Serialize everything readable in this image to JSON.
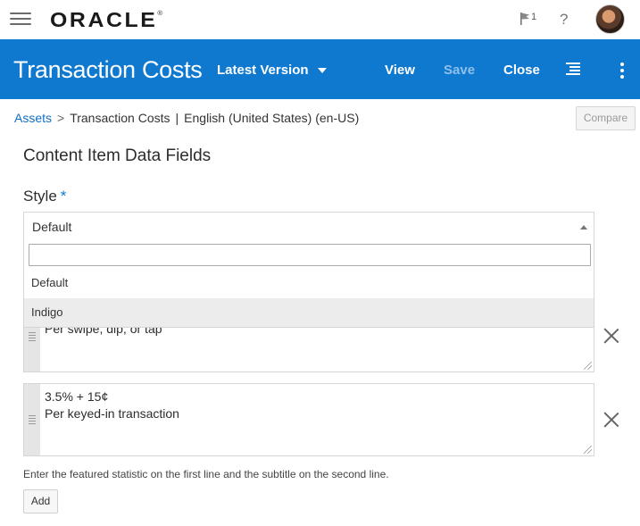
{
  "header": {
    "logo_text": "ORACLE",
    "logo_mark": "®",
    "notification_count": "1",
    "help_label": "?",
    "icons": {
      "menu": "hamburger-icon",
      "flag": "flag-icon",
      "help": "help-icon",
      "avatar": "user-avatar"
    }
  },
  "toolbar": {
    "title": "Transaction Costs",
    "version_label": "Latest Version",
    "view_label": "View",
    "save_label": "Save",
    "save_disabled": true,
    "close_label": "Close",
    "accent_color": "#0f79cf"
  },
  "breadcrumb": {
    "assets": "Assets",
    "separator": ">",
    "item": "Transaction Costs",
    "divider": "|",
    "locale": "English (United States) (en-US)"
  },
  "compare_label": "Compare",
  "section_title": "Content Item Data Fields",
  "style_field": {
    "label": "Style",
    "required_mark": "*",
    "selected": "Default",
    "search_value": "",
    "options": [
      "Default",
      "Indigo"
    ],
    "highlighted_option": "Indigo"
  },
  "stats": [
    {
      "text": "Per swipe, dip, or tap"
    },
    {
      "text": "3.5% + 15¢\nPer keyed-in transaction"
    }
  ],
  "hint": "Enter the featured statistic on the first line and the subtitle on the second line.",
  "add_label": "Add"
}
